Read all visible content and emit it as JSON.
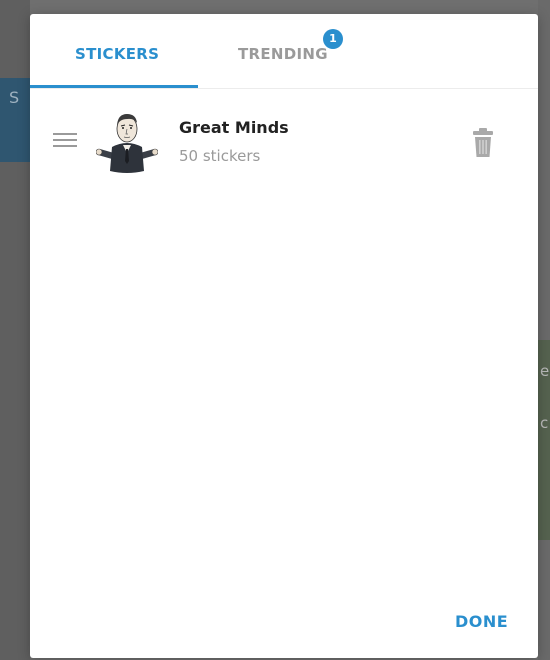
{
  "background": {
    "left_text": "S",
    "right_texts": [
      "e",
      "c"
    ]
  },
  "tabs": [
    {
      "label": "STICKERS",
      "active": true
    },
    {
      "label": "TRENDING",
      "active": false,
      "badge": "1"
    }
  ],
  "sticker_sets": [
    {
      "name": "Great Minds",
      "count": "50 stickers",
      "thumbnail_icon": "man-in-suit-sticker"
    }
  ],
  "footer": {
    "done_label": "DONE"
  },
  "colors": {
    "accent": "#2a8fce",
    "muted": "#9a9a9a",
    "title": "#222222"
  }
}
